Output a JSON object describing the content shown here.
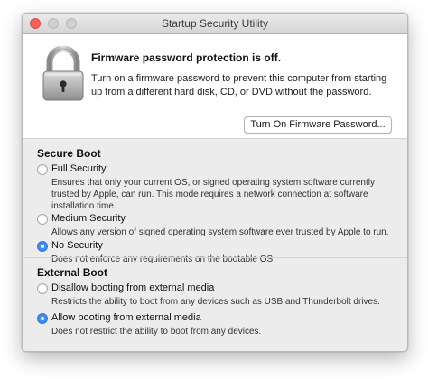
{
  "window": {
    "title": "Startup Security Utility"
  },
  "firmware": {
    "heading": "Firmware password protection is off.",
    "description": "Turn on a firmware password to prevent this computer from starting up from a different hard disk, CD, or DVD without the password.",
    "button_label": "Turn On Firmware Password...",
    "icon": "padlock-icon"
  },
  "secure_boot": {
    "heading": "Secure Boot",
    "options": [
      {
        "label": "Full Security",
        "description": "Ensures that only your current OS, or signed operating system software currently trusted by Apple, can run. This mode requires a network connection at software installation time.",
        "selected": false
      },
      {
        "label": "Medium Security",
        "description": "Allows any version of signed operating system software ever trusted by Apple to run.",
        "selected": false
      },
      {
        "label": "No Security",
        "description": "Does not enforce any requirements on the bootable OS.",
        "selected": true
      }
    ]
  },
  "external_boot": {
    "heading": "External Boot",
    "options": [
      {
        "label": "Disallow booting from external media",
        "description": "Restricts the ability to boot from any devices such as USB and Thunderbolt drives.",
        "selected": false
      },
      {
        "label": "Allow booting from external media",
        "description": "Does not restrict the ability to boot from any devices.",
        "selected": true
      }
    ]
  },
  "colors": {
    "accent": "#3d8ff4",
    "close_button": "#fc605c",
    "window_background": "#ececec"
  }
}
